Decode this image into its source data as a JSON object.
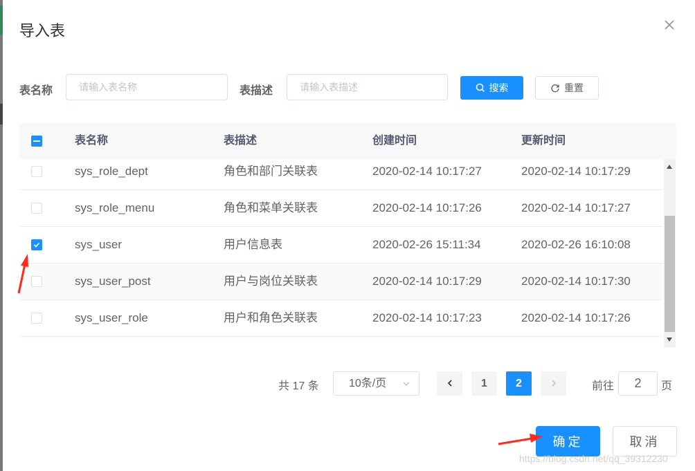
{
  "dialog": {
    "title": "导入表"
  },
  "search": {
    "table_name_label": "表名称",
    "table_name_placeholder": "请输入表名称",
    "table_desc_label": "表描述",
    "table_desc_placeholder": "请输入表描述",
    "search_button": "搜索",
    "reset_button": "重置"
  },
  "table": {
    "columns": [
      "表名称",
      "表描述",
      "创建时间",
      "更新时间"
    ],
    "rows": [
      {
        "name": "sys_role_dept",
        "desc": "角色和部门关联表",
        "created": "2020-02-14 10:17:27",
        "updated": "2020-02-14 10:17:29",
        "checked": false
      },
      {
        "name": "sys_role_menu",
        "desc": "角色和菜单关联表",
        "created": "2020-02-14 10:17:26",
        "updated": "2020-02-14 10:17:27",
        "checked": false
      },
      {
        "name": "sys_user",
        "desc": "用户信息表",
        "created": "2020-02-26 15:11:34",
        "updated": "2020-02-26 16:10:08",
        "checked": true
      },
      {
        "name": "sys_user_post",
        "desc": "用户与岗位关联表",
        "created": "2020-02-14 10:17:29",
        "updated": "2020-02-14 10:17:30",
        "checked": false
      },
      {
        "name": "sys_user_role",
        "desc": "用户和角色关联表",
        "created": "2020-02-14 10:17:23",
        "updated": "2020-02-14 10:17:26",
        "checked": false
      }
    ]
  },
  "pagination": {
    "total_text": "共 17 条",
    "page_size": "10条/页",
    "pages": [
      "1",
      "2"
    ],
    "current_page": "2",
    "jump_prefix": "前往",
    "jump_value": "2",
    "jump_suffix": "页"
  },
  "footer": {
    "confirm": "确定",
    "cancel": "取消"
  },
  "watermark": "https://blog.csdn.net/qq_39312230",
  "colors": {
    "primary": "#1890ff",
    "annotation_arrow": "#ff2a1a"
  }
}
